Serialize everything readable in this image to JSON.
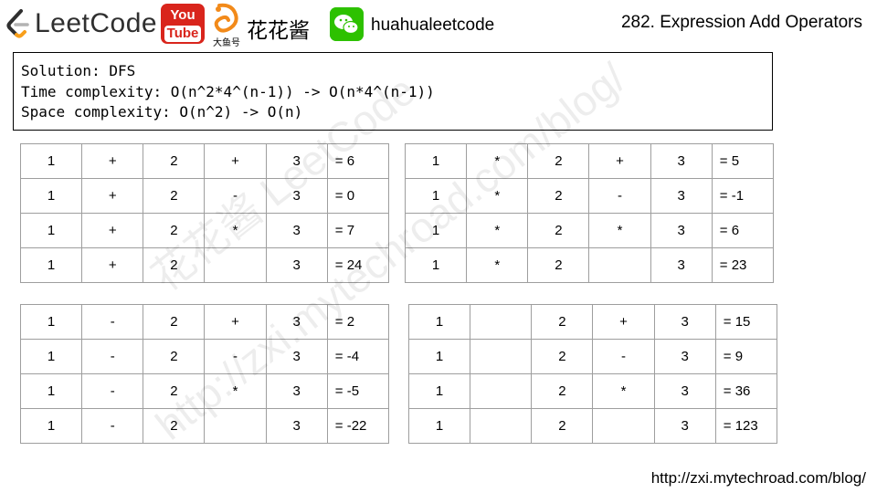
{
  "header": {
    "logo_text": "LeetCode",
    "youtube_top": "You",
    "youtube_bottom": "Tube",
    "douyu_sub": "大鱼号",
    "author_name": "花花酱",
    "wechat_name": "huahualeetcode",
    "problem_title": "282. Expression Add Operators"
  },
  "solution": {
    "line1": "Solution: DFS",
    "line2": "Time complexity: O(n^2*4^(n-1)) -> O(n*4^(n-1))",
    "line3": "Space complexity: O(n^2) -> O(n)"
  },
  "tables": {
    "t1": [
      [
        "1",
        "+",
        "2",
        "+",
        "3",
        "= 6"
      ],
      [
        "1",
        "+",
        "2",
        "-",
        "3",
        "= 0"
      ],
      [
        "1",
        "+",
        "2",
        "*",
        "3",
        "= 7"
      ],
      [
        "1",
        "+",
        "2",
        "",
        "3",
        "= 24"
      ]
    ],
    "t2": [
      [
        "1",
        "*",
        "2",
        "+",
        "3",
        "= 5"
      ],
      [
        "1",
        "*",
        "2",
        "-",
        "3",
        "= -1"
      ],
      [
        "1",
        "*",
        "2",
        "*",
        "3",
        "= 6"
      ],
      [
        "1",
        "*",
        "2",
        "",
        "3",
        "= 23"
      ]
    ],
    "t3": [
      [
        "1",
        "-",
        "2",
        "+",
        "3",
        "= 2"
      ],
      [
        "1",
        "-",
        "2",
        "-",
        "3",
        "= -4"
      ],
      [
        "1",
        "-",
        "2",
        "*",
        "3",
        "= -5"
      ],
      [
        "1",
        "-",
        "2",
        "",
        "3",
        "= -22"
      ]
    ],
    "t4": [
      [
        "1",
        "",
        "2",
        "+",
        "3",
        "= 15"
      ],
      [
        "1",
        "",
        "2",
        "-",
        "3",
        "= 9"
      ],
      [
        "1",
        "",
        "2",
        "*",
        "3",
        "= 36"
      ],
      [
        "1",
        "",
        "2",
        "",
        "3",
        "= 123"
      ]
    ]
  },
  "watermark": {
    "line1": "花花酱 LeetCode",
    "line2": "http://zxi.mytechroad.com/blog/"
  },
  "footer": {
    "url": "http://zxi.mytechroad.com/blog/"
  },
  "colors": {
    "youtube_red": "#d9251c",
    "wechat_green": "#2dc100",
    "leetcode_orange": "#f89f1b",
    "grid_border": "#9e9e9e"
  }
}
